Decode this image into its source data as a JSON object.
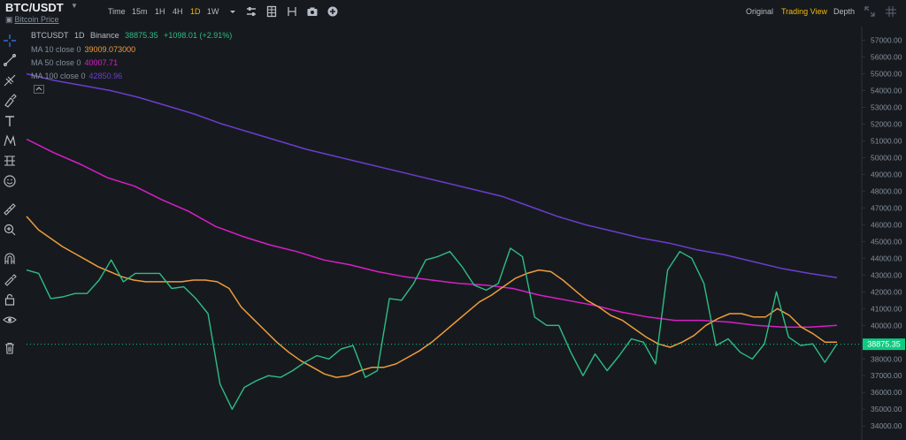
{
  "header": {
    "symbol": "BTC/USDT",
    "subtitle": "Bitcoin Price",
    "intervals": [
      {
        "label": "Time",
        "active": false
      },
      {
        "label": "15m",
        "active": false
      },
      {
        "label": "1H",
        "active": false
      },
      {
        "label": "4H",
        "active": false
      },
      {
        "label": "1D",
        "active": true
      },
      {
        "label": "1W",
        "active": false
      }
    ],
    "views": [
      {
        "label": "Original",
        "active": false
      },
      {
        "label": "Trading View",
        "active": true
      },
      {
        "label": "Depth",
        "active": false
      }
    ]
  },
  "icons": {
    "dropdown": "chevron-down-icon",
    "indicators": "sliders-icon",
    "layout": "grid-icon",
    "screenshot": "camera-icon",
    "add": "plus-circle-icon",
    "expand": "expand-icon",
    "grid_toggle": "grid-toggle-icon",
    "left_tools": [
      "crosshair-icon",
      "trendline-icon",
      "fib-icon",
      "brush-icon",
      "text-icon",
      "pattern-icon",
      "measure-icon",
      "emoji-icon",
      "ruler-icon",
      "zoom-icon",
      "magnet-icon",
      "lock-drawing-icon",
      "lock-icon",
      "eye-icon",
      "trash-icon"
    ]
  },
  "legend": {
    "main": {
      "pair": "BTCUSDT",
      "interval": "1D",
      "exchange": "Binance",
      "price": "38875.35",
      "change": "+1098.01 (+2.91%)"
    },
    "ma": [
      {
        "label": "MA 10 close 0",
        "value": "39009.073000",
        "color": "#ee9b3d"
      },
      {
        "label": "MA 50 close 0",
        "value": "40007.71",
        "color": "#d81ec7"
      },
      {
        "label": "MA 100 close 0",
        "value": "42850.96",
        "color": "#6b3dd0"
      }
    ]
  },
  "colors": {
    "background": "#161a1e",
    "price": "#2ebd85",
    "last_price": "#0ecb81",
    "axis_text": "#848e9c",
    "accent": "#f0b90b"
  },
  "chart_data": {
    "type": "line",
    "ylim": [
      33800,
      57500
    ],
    "y_ticks": [
      "34000.00",
      "35000.00",
      "36000.00",
      "37000.00",
      "38000.00",
      "39000.00",
      "40000.00",
      "41000.00",
      "42000.00",
      "43000.00",
      "44000.00",
      "45000.00",
      "46000.00",
      "47000.00",
      "48000.00",
      "49000.00",
      "50000.00",
      "51000.00",
      "52000.00",
      "53000.00",
      "54000.00",
      "55000.00",
      "56000.00",
      "57000.00"
    ],
    "last_price": 38875.35,
    "last_price_label": "38875.35",
    "series": [
      {
        "name": "BTCUSDT",
        "color": "#2ebd85",
        "values": [
          43300,
          43100,
          41600,
          41700,
          41900,
          41900,
          42700,
          43900,
          42600,
          43100,
          43100,
          43100,
          42200,
          42300,
          41600,
          40700,
          36500,
          35000,
          36300,
          36700,
          37000,
          36900,
          37300,
          37800,
          38200,
          38000,
          38600,
          38800,
          36900,
          37300,
          41600,
          41500,
          42500,
          43900,
          44100,
          44400,
          43500,
          42400,
          42100,
          42500,
          44600,
          44100,
          40500,
          40000,
          40000,
          38400,
          37000,
          38300,
          37300,
          38200,
          39200,
          39000,
          37700,
          43300,
          44400,
          44000,
          42500,
          38800,
          39200,
          38400,
          38000,
          38900,
          42000,
          39300,
          38800,
          38900,
          37800,
          38900
        ]
      },
      {
        "name": "MA 10 close 0",
        "color": "#ee9b3d",
        "values": [
          46500,
          45700,
          45200,
          44700,
          44300,
          43900,
          43500,
          43200,
          42900,
          42700,
          42600,
          42600,
          42600,
          42600,
          42700,
          42700,
          42600,
          42200,
          41100,
          40400,
          39700,
          39000,
          38400,
          37900,
          37500,
          37100,
          36900,
          37000,
          37300,
          37500,
          37500,
          37700,
          38100,
          38500,
          39000,
          39600,
          40200,
          40800,
          41400,
          41800,
          42300,
          42800,
          43100,
          43300,
          43200,
          42700,
          42100,
          41500,
          41100,
          40600,
          40300,
          39800,
          39300,
          38900,
          38700,
          39000,
          39400,
          40000,
          40400,
          40700,
          40700,
          40500,
          40500,
          41000,
          40600,
          39900,
          39500,
          39000,
          39000
        ]
      },
      {
        "name": "MA 50 close 0",
        "color": "#d81ec7",
        "values": [
          51100,
          50300,
          49600,
          48800,
          48300,
          47500,
          46800,
          45900,
          45300,
          44800,
          44400,
          43900,
          43600,
          43200,
          42900,
          42700,
          42500,
          42400,
          42200,
          41800,
          41500,
          41200,
          40800,
          40500,
          40300,
          40300,
          40200,
          40000,
          39900,
          39900,
          40000
        ]
      },
      {
        "name": "MA 100 close 0",
        "color": "#6b3dd0",
        "values": [
          55000,
          54600,
          54300,
          54000,
          53600,
          53100,
          52600,
          52000,
          51500,
          51000,
          50500,
          50100,
          49700,
          49300,
          48900,
          48500,
          48100,
          47700,
          47100,
          46500,
          46000,
          45600,
          45200,
          44900,
          44500,
          44200,
          43800,
          43400,
          43100,
          42850
        ]
      }
    ]
  }
}
